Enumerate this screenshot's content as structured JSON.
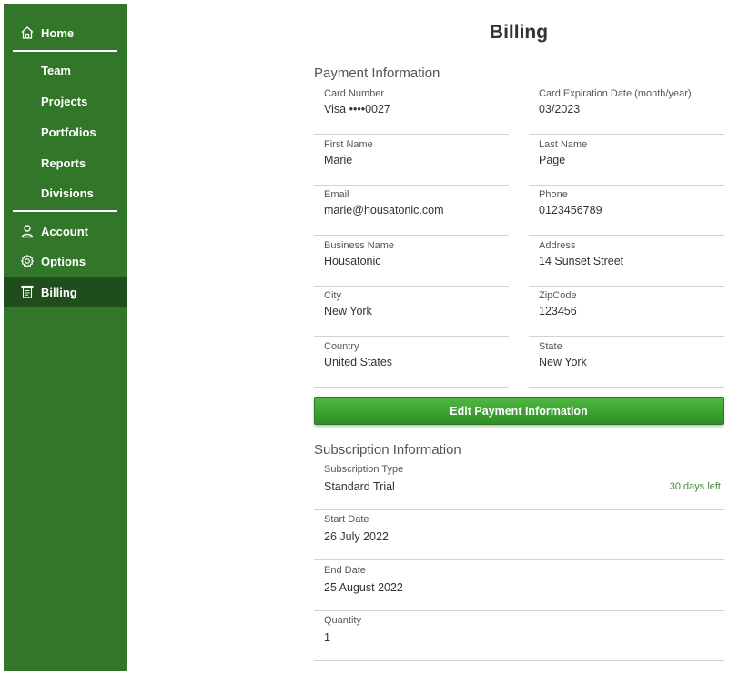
{
  "sidebar": {
    "items": [
      {
        "label": "Home",
        "icon": "home-icon"
      },
      {
        "label": "Team"
      },
      {
        "label": "Projects"
      },
      {
        "label": "Portfolios"
      },
      {
        "label": "Reports"
      },
      {
        "label": "Divisions"
      },
      {
        "label": "Account",
        "icon": "user-icon"
      },
      {
        "label": "Options",
        "icon": "gear-icon"
      },
      {
        "label": "Billing",
        "icon": "receipt-icon",
        "active": true
      }
    ]
  },
  "page": {
    "title": "Billing"
  },
  "payment": {
    "section_title": "Payment Information",
    "fields": [
      {
        "label": "Card Number",
        "value": "Visa ••••0027"
      },
      {
        "label": "Card Expiration Date (month/year)",
        "value": "03/2023"
      },
      {
        "label": "First Name",
        "value": "Marie"
      },
      {
        "label": "Last Name",
        "value": "Page"
      },
      {
        "label": "Email",
        "value": "marie@housatonic.com"
      },
      {
        "label": "Phone",
        "value": "0123456789"
      },
      {
        "label": "Business Name",
        "value": "Housatonic"
      },
      {
        "label": "Address",
        "value": "14 Sunset Street"
      },
      {
        "label": "City",
        "value": "New York"
      },
      {
        "label": "ZipCode",
        "value": "123456"
      },
      {
        "label": "Country",
        "value": "United States"
      },
      {
        "label": "State",
        "value": "New York"
      }
    ],
    "edit_button_label": "Edit Payment Information"
  },
  "subscription": {
    "section_title": "Subscription Information",
    "fields": [
      {
        "label": "Subscription Type",
        "value": "Standard Trial",
        "badge": "30 days left"
      },
      {
        "label": "Start Date",
        "value": "26 July 2022"
      },
      {
        "label": "End Date",
        "value": "25 August 2022"
      },
      {
        "label": "Quantity",
        "value": "1"
      }
    ]
  },
  "colors": {
    "sidebar": "#327629",
    "active": "#1f4d1b",
    "accent": "#3d8c31"
  }
}
